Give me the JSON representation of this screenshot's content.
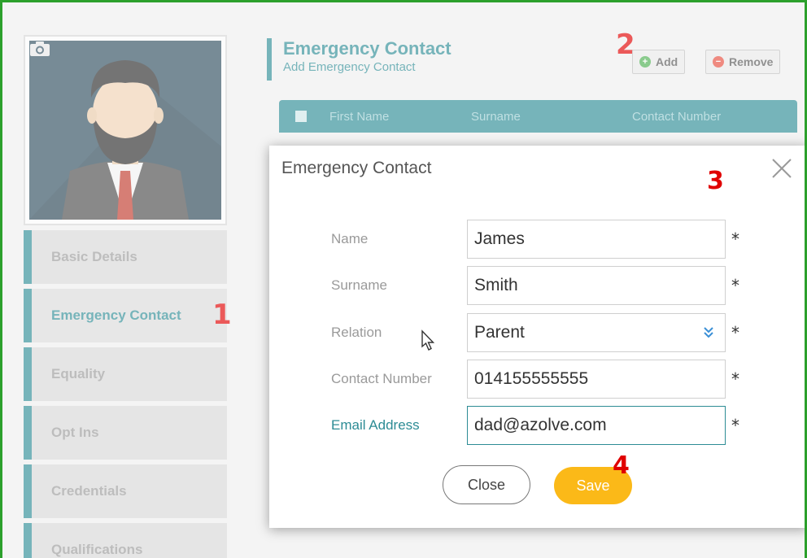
{
  "header": {
    "title": "Emergency Contact",
    "subtitle": "Add Emergency Contact",
    "add_label": "Add",
    "remove_label": "Remove"
  },
  "grid": {
    "columns": [
      "First Name",
      "Surname",
      "Contact Number"
    ]
  },
  "sidebar": {
    "items": [
      {
        "label": "Basic Details"
      },
      {
        "label": "Emergency Contact"
      },
      {
        "label": "Equality"
      },
      {
        "label": "Opt Ins"
      },
      {
        "label": "Credentials"
      },
      {
        "label": "Qualifications"
      }
    ]
  },
  "steps": [
    "1",
    "2",
    "3",
    "4"
  ],
  "modal": {
    "title": "Emergency Contact",
    "required_mark": "*",
    "fields": [
      {
        "label": "Name",
        "value": "James"
      },
      {
        "label": "Surname",
        "value": "Smith"
      },
      {
        "label": "Relation",
        "value": "Parent"
      },
      {
        "label": "Contact Number",
        "value": "014155555555"
      },
      {
        "label": "Email Address",
        "value": "dad@azolve.com"
      }
    ],
    "close_label": "Close",
    "save_label": "Save"
  },
  "colors": {
    "accent": "#2d8c95",
    "save": "#fbb918",
    "annotation": "#e00000",
    "frame": "#2ca02c"
  },
  "icons": [
    "camera-icon",
    "add-icon",
    "remove-icon",
    "close-icon",
    "chevron-down-icon",
    "cursor-icon"
  ]
}
